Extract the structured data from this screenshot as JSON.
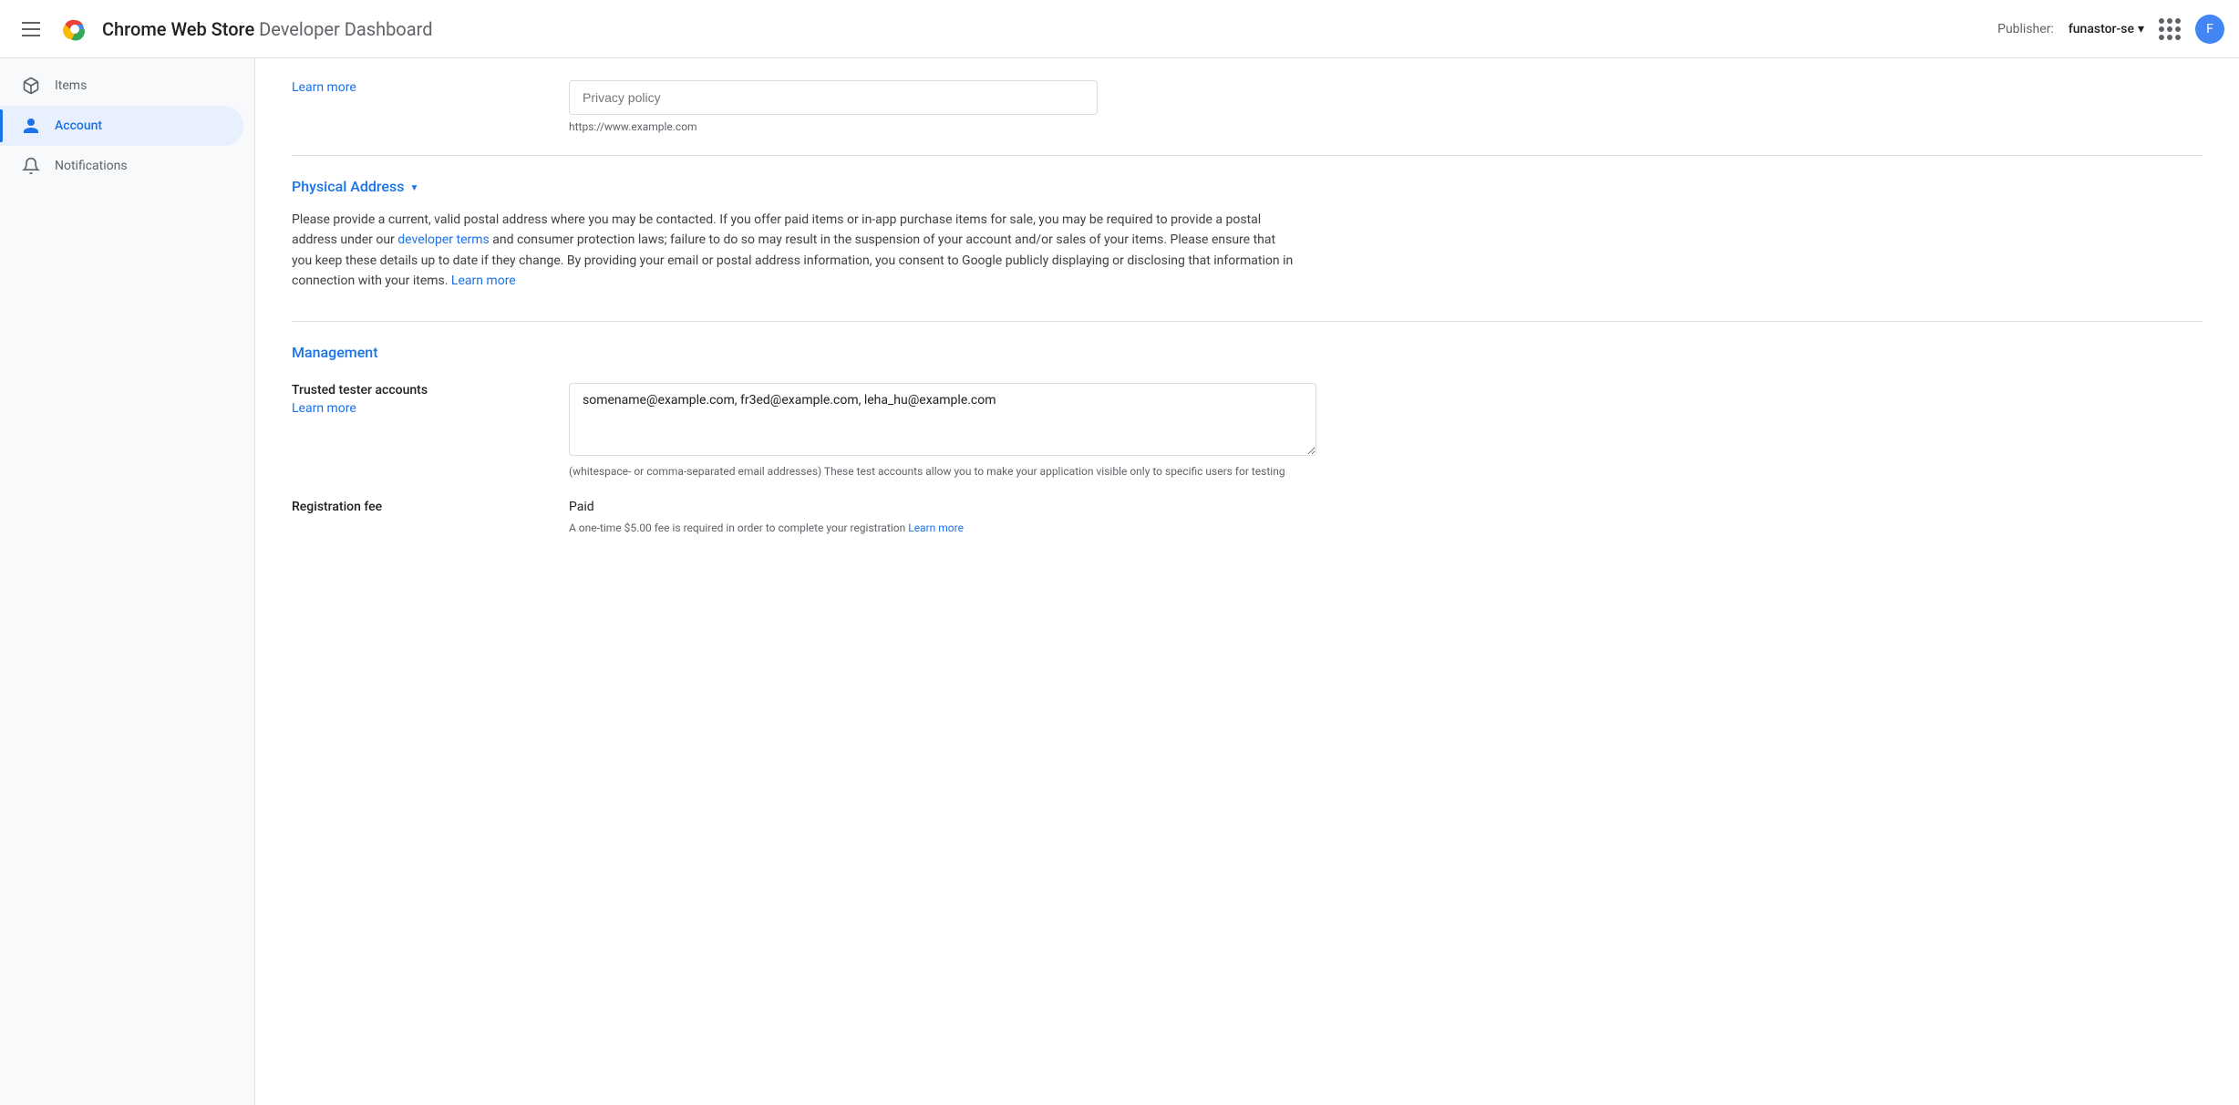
{
  "header": {
    "menu_icon": "hamburger-icon",
    "logo_alt": "Chrome logo",
    "title_store": "Chrome Web Store",
    "title_sub": "Developer Dashboard",
    "publisher_label": "Publisher:",
    "publisher_name": "funastor-se",
    "dropdown_icon": "chevron-down-icon",
    "grid_icon": "grid-icon",
    "avatar_letter": "F"
  },
  "sidebar": {
    "items": [
      {
        "id": "items",
        "label": "Items",
        "icon": "package-icon",
        "active": false
      },
      {
        "id": "account",
        "label": "Account",
        "icon": "account-circle-icon",
        "active": true
      },
      {
        "id": "notifications",
        "label": "Notifications",
        "icon": "bell-icon",
        "active": false
      }
    ]
  },
  "main": {
    "privacy_policy": {
      "learn_more_label": "Learn more",
      "placeholder": "Privacy policy",
      "url_hint": "https://www.example.com"
    },
    "physical_address": {
      "section_title": "Physical Address",
      "description": "Please provide a current, valid postal address where you may be contacted. If you offer paid items or in-app purchase items for sale, you may be required to provide a postal address under our ",
      "developer_terms_link": "developer terms",
      "description_cont": " and consumer protection laws; failure to do so may result in the suspension of your account and/or sales of your items. Please ensure that you keep these details up to date if they change. By providing your email or postal address information, you consent to Google publicly displaying or disclosing that information in connection with your items. ",
      "learn_more_link": "Learn more"
    },
    "management": {
      "section_title": "Management",
      "trusted_tester": {
        "label": "Trusted tester accounts",
        "learn_more": "Learn more",
        "value": "somename@example.com, fr3ed@example.com, leha_hu@example.com",
        "hint": "(whitespace- or comma-separated email addresses) These test accounts allow you to make your application visible only to specific users for testing"
      },
      "registration_fee": {
        "label": "Registration fee",
        "value": "Paid",
        "hint": "A one-time $5.00 fee is required in order to complete your registration ",
        "learn_more": "Learn more"
      }
    }
  }
}
